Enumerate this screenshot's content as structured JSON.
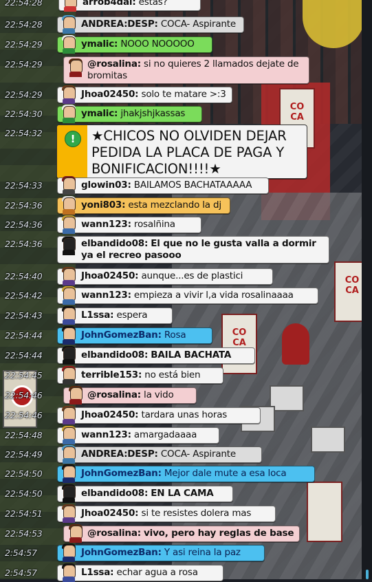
{
  "colors": {
    "bubble_white": "#f4f4f4",
    "bubble_green": "#7bdc5b",
    "bubble_pink": "#f3cfd2",
    "bubble_blue": "#4cc0f0",
    "bubble_orange": "#f6c25a",
    "alert_stripe": "#f7b500",
    "timestamp": "#d6dce4"
  },
  "scene": {
    "banner_text": "CO\nCA"
  },
  "chat": {
    "top_partial": {
      "time": "22:54:28",
      "user": "arrob4dal:",
      "text": "estas?"
    },
    "messages": [
      {
        "time": "22:54:28",
        "user": "ANDREA:DESP:",
        "text": "COCA- Aspirante"
      },
      {
        "time": "22:54:29",
        "user": "ymalic:",
        "text": "NOOO  NOOOOO"
      },
      {
        "time": "22:54:29",
        "user": "@rosalina:",
        "text": "si no quieres 2 llamados dejate de bromitas"
      },
      {
        "time": "22:54:29",
        "user": "Jhoa02450:",
        "text": "solo te matare >:3"
      },
      {
        "time": "22:54:30",
        "user": "ymalic:",
        "text": "jhakjshjkassas"
      },
      {
        "time": "22:54:33",
        "user": "glowin03:",
        "text": "BAILAMOS BACHATAAAAA"
      },
      {
        "time": "22:54:36",
        "user": "yoni803:",
        "text": "esta mezclando la dj"
      },
      {
        "time": "22:54:36",
        "user": "wann123:",
        "text": "rosalñina"
      },
      {
        "time": "22:54:36",
        "user": "elbandido08:",
        "text": "El que no le gusta valla a dormir ya el recreo pasooo"
      },
      {
        "time": "22:54:40",
        "user": "Jhoa02450:",
        "text": "aunque...es de plastici"
      },
      {
        "time": "22:54:42",
        "user": "wann123:",
        "text": "empieza a vivir l,a vida rosalinaaaa"
      },
      {
        "time": "22:54:43",
        "user": "L1ssa:",
        "text": "espera"
      },
      {
        "time": "22:54:44",
        "user": "JohnGomezBan:",
        "text": "Rosa"
      },
      {
        "time": "22:54:44",
        "user": "elbandido08:",
        "text": "BAILA BACHATA"
      },
      {
        "time": "22:54:45",
        "user": "terrible153:",
        "text": "no está bien"
      },
      {
        "time": "22:54:46",
        "user": "@rosalina:",
        "text": "la vido"
      },
      {
        "time": "22:54:46",
        "user": "Jhoa02450:",
        "text": "tardara unas horas"
      },
      {
        "time": "22:54:48",
        "user": "wann123:",
        "text": "amargadaaaa"
      },
      {
        "time": "22:54:49",
        "user": "ANDREA:DESP:",
        "text": "COCA- Aspirante"
      },
      {
        "time": "22:54:50",
        "user": "JohnGomezBan:",
        "text": "Mejor dale mute a esa loca"
      },
      {
        "time": "22:54:50",
        "user": "elbandido08:",
        "text": "EN LA CAMA"
      },
      {
        "time": "22:54:51",
        "user": "Jhoa02450:",
        "text": "si te resistes dolera mas"
      },
      {
        "time": "22:54:53",
        "user": "@rosalina:",
        "text": "vivo, pero hay reglas de base"
      },
      {
        "time": "2:54:57",
        "user": "JohnGomezBan:",
        "text": "Y asi reina la paz"
      },
      {
        "time": "2:54:57",
        "user": "L1ssa:",
        "text": "echar agua a rosa"
      }
    ],
    "alert": {
      "time": "22:54:32",
      "icon": "exclamation-icon",
      "icon_glyph": "!",
      "text": "★CHICOS NO OLVIDEN DEJAR PEDIDA LA PLACA DE PAGA Y BONIFICACION!!!!★"
    }
  }
}
